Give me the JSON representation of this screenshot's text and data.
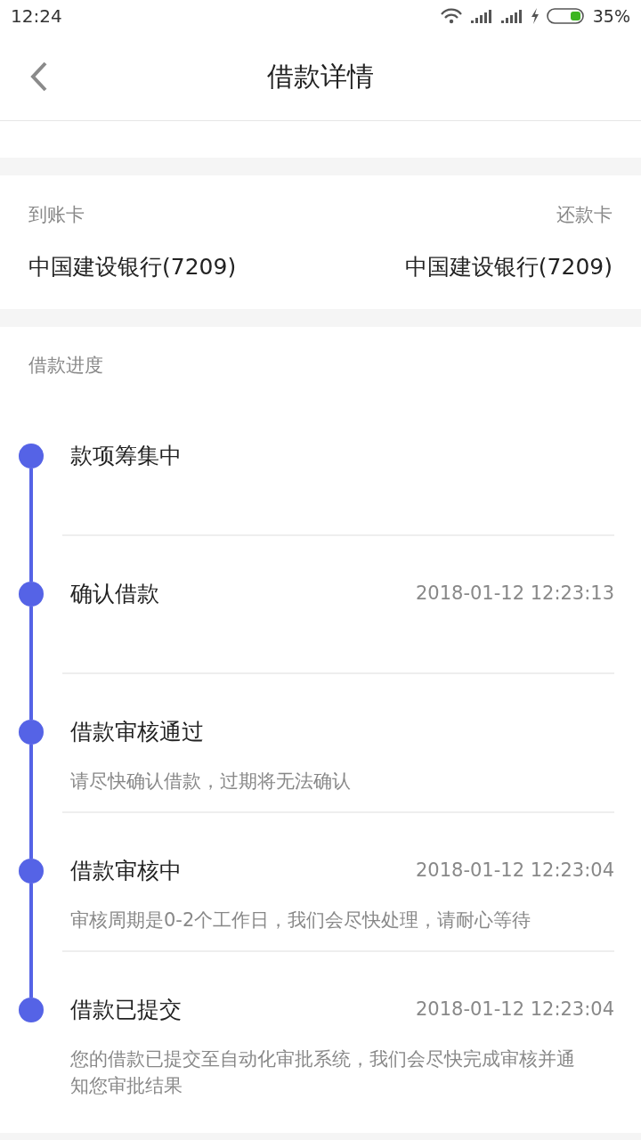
{
  "status_bar": {
    "time": "12:24",
    "battery": "35%"
  },
  "header": {
    "title": "借款详情"
  },
  "cards": {
    "arrival_label": "到账卡",
    "repay_label": "还款卡",
    "arrival_card": "中国建设银行(7209)",
    "repay_card": "中国建设银行(7209)"
  },
  "progress": {
    "title": "借款进度",
    "steps": [
      {
        "title": "款项筹集中"
      },
      {
        "title": "确认借款",
        "time": "2018-01-12 12:23:13"
      },
      {
        "title": "借款审核通过",
        "note": "请尽快确认借款，过期将无法确认"
      },
      {
        "title": "借款审核中",
        "time": "2018-01-12 12:23:04",
        "note": "审核周期是0-2个工作日，我们会尽快处理，请耐心等待"
      },
      {
        "title": "借款已提交",
        "time": "2018-01-12 12:23:04",
        "note": "您的借款已提交至自动化审批系统，我们会尽快完成审核并通知您审批结果"
      }
    ]
  }
}
